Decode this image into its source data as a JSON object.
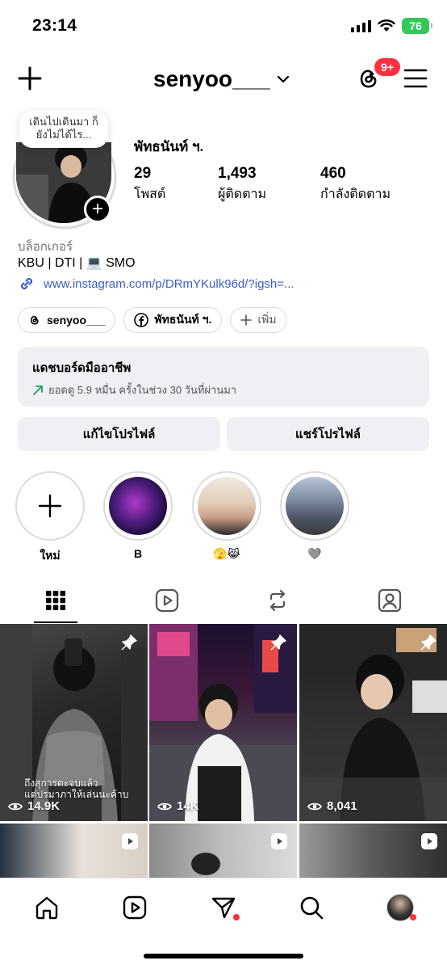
{
  "status_bar": {
    "time": "23:14",
    "battery": "76"
  },
  "header": {
    "username": "senyoo___",
    "notification_badge": "9+"
  },
  "profile": {
    "note": "เดินไปเดินมา ก็ยังไม่ได้ไร...",
    "full_name": "พัทธนันท์ ฯ.",
    "stats": [
      {
        "value": "29",
        "label": "โพสต์"
      },
      {
        "value": "1,493",
        "label": "ผู้ติดตาม"
      },
      {
        "value": "460",
        "label": "กำลังติดตาม"
      }
    ],
    "category": "บล็อกเกอร์",
    "bio": "KBU | DTI | 💻 SMO",
    "link": "www.instagram.com/p/DRmYKulk96d/?igsh=..."
  },
  "chips": [
    {
      "label": "senyoo___",
      "icon": "threads-icon"
    },
    {
      "label": "พัทธนันท์ ฯ.",
      "icon": "facebook-icon"
    },
    {
      "label": "เพิ่ม",
      "icon": "plus-icon"
    }
  ],
  "dashboard": {
    "title": "แดชบอร์ดมืออาชีพ",
    "subtitle": "ยอดดู 5.9 หมื่น ครั้งในช่วง 30 วันที่ผ่านมา",
    "accent": "#1a9e54"
  },
  "buttons": {
    "edit": "แก้ไขโปรไฟล์",
    "share": "แชร์โปรไฟล์"
  },
  "highlights": [
    {
      "label": "ใหม่"
    },
    {
      "label": "B"
    },
    {
      "label": "🫣😹"
    },
    {
      "label": "🩶"
    }
  ],
  "tabs": [
    "grid-icon",
    "reels-icon",
    "reposts-icon",
    "tagged-icon"
  ],
  "posts": [
    {
      "views": "14.9K",
      "pinned": true,
      "caption_line1": "ถึงสุการตะจบแล้ว",
      "caption_line2": "แต่ปรมาภาให้เล่นนะค้าบ"
    },
    {
      "views": "14K",
      "pinned": true
    },
    {
      "views": "8,041",
      "pinned": true
    }
  ],
  "nav": [
    "home-icon",
    "reels-icon",
    "messages-icon",
    "search-icon",
    "profile-avatar"
  ],
  "colors": {
    "badge_red": "#ff3040",
    "link_blue": "#3b5fc4",
    "battery_green": "#34c759"
  }
}
